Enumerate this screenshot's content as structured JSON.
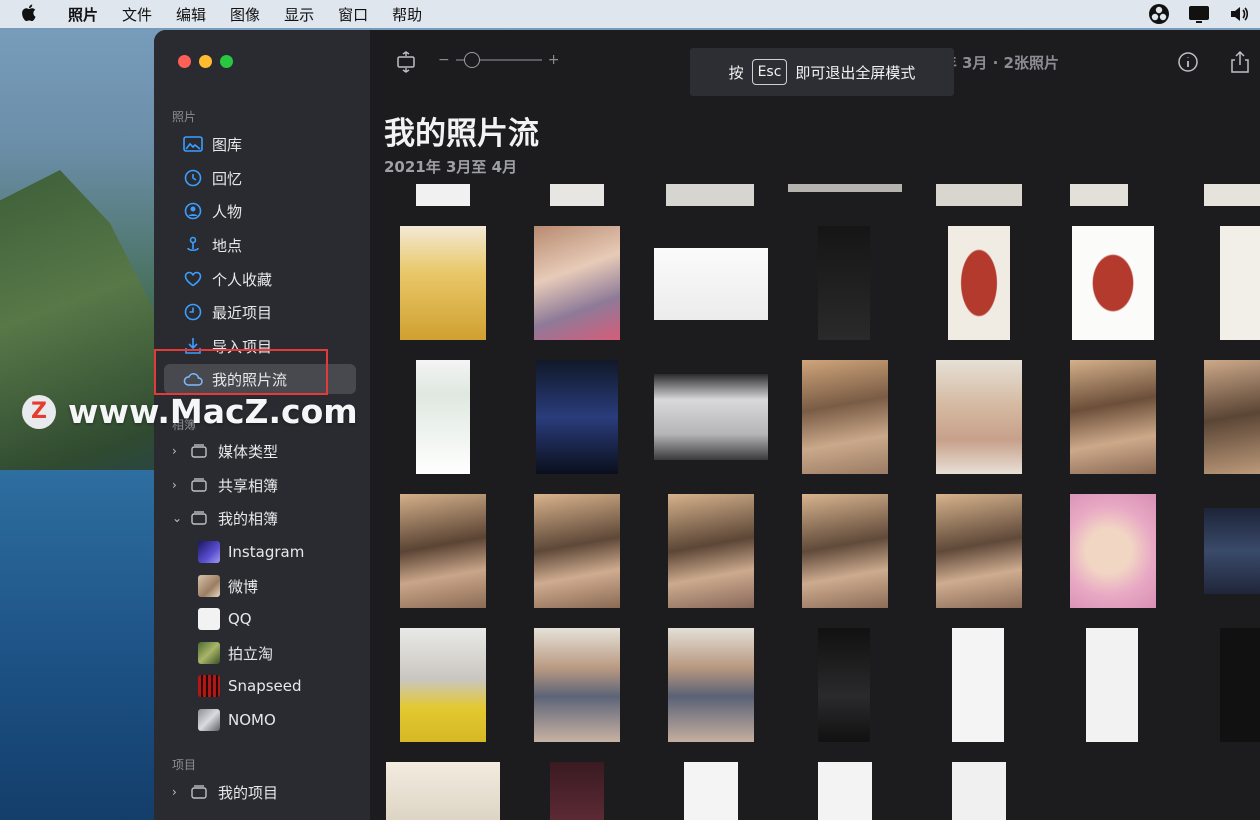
{
  "menubar": {
    "items": [
      "照片",
      "文件",
      "编辑",
      "图像",
      "显示",
      "窗口",
      "帮助"
    ]
  },
  "sidebar": {
    "section_photos": "照片",
    "items": [
      {
        "label": "图库",
        "icon": "photo-library-icon"
      },
      {
        "label": "回忆",
        "icon": "memories-icon"
      },
      {
        "label": "人物",
        "icon": "people-icon"
      },
      {
        "label": "地点",
        "icon": "places-icon"
      },
      {
        "label": "个人收藏",
        "icon": "heart-icon"
      },
      {
        "label": "最近项目",
        "icon": "clock-icon"
      },
      {
        "label": "导入项目",
        "icon": "import-icon"
      },
      {
        "label": "我的照片流",
        "icon": "cloud-icon",
        "selected": true
      }
    ],
    "section_albums": "相簿",
    "album_groups": [
      {
        "label": "媒体类型"
      },
      {
        "label": "共享相簿"
      },
      {
        "label": "我的相簿"
      }
    ],
    "albums": [
      {
        "label": "Instagram"
      },
      {
        "label": "微博"
      },
      {
        "label": "QQ"
      },
      {
        "label": "拍立淘"
      },
      {
        "label": "Snapseed"
      },
      {
        "label": "NOMO"
      }
    ],
    "section_projects": "项目",
    "projects_group": "我的项目"
  },
  "main": {
    "title": "我的照片流",
    "subtitle": "2021年 3月至 4月",
    "toolbar_date": "2021年 3月 · 2张照片",
    "esc_hint": {
      "before": "按",
      "key": "Esc",
      "after": "即可退出全屏模式"
    },
    "zoom_minus": "−",
    "zoom_plus": "+"
  },
  "watermark": {
    "logo": "Z",
    "text": "www.MacZ.com"
  }
}
